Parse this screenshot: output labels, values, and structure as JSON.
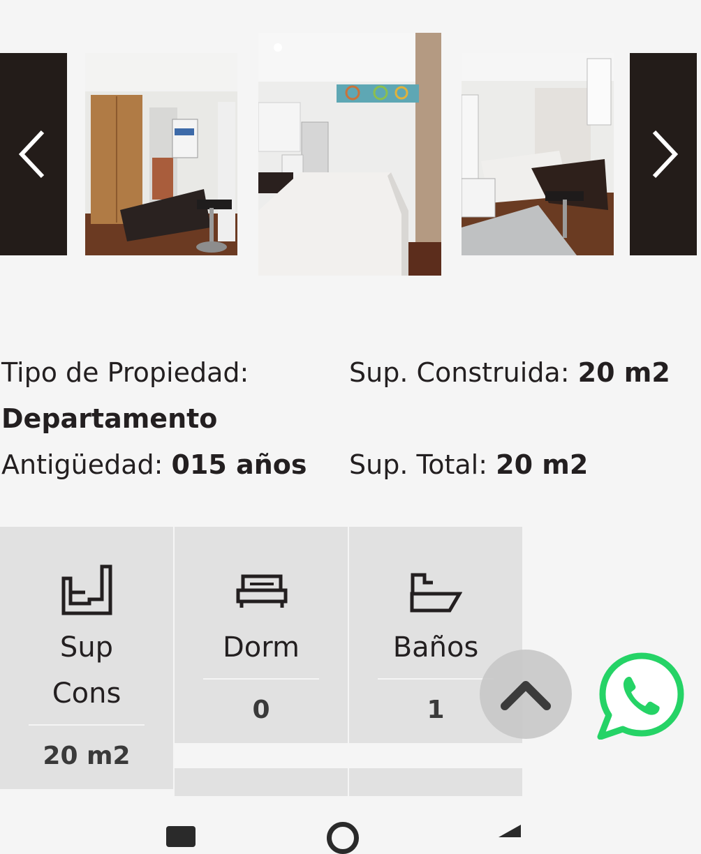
{
  "carousel": {
    "prev_icon": "chevron-left-icon",
    "next_icon": "chevron-right-icon",
    "images": [
      "kitchen-dining-photo",
      "bedroom-photo",
      "studio-overview-photo"
    ]
  },
  "details": {
    "tipo_label": "Tipo de Propiedad:",
    "tipo_value": "Departamento",
    "sup_construida_label": "Sup. Construida:",
    "sup_construida_value": "20 m2",
    "antiguedad_label": "Antigüedad:",
    "antiguedad_value": "015 años",
    "sup_total_label": "Sup. Total:",
    "sup_total_value": "20 m2"
  },
  "stats": [
    {
      "icon": "floorplan-icon",
      "label_line1": "Sup",
      "label_line2": "Cons",
      "value": "20 m2"
    },
    {
      "icon": "bed-icon",
      "label": "Dorm",
      "value": "0"
    },
    {
      "icon": "bathtub-icon",
      "label": "Baños",
      "value": "1"
    }
  ],
  "floating": {
    "scroll_top_icon": "chevron-up-icon",
    "whatsapp_icon": "whatsapp-icon",
    "whatsapp_color": "#25d366"
  }
}
